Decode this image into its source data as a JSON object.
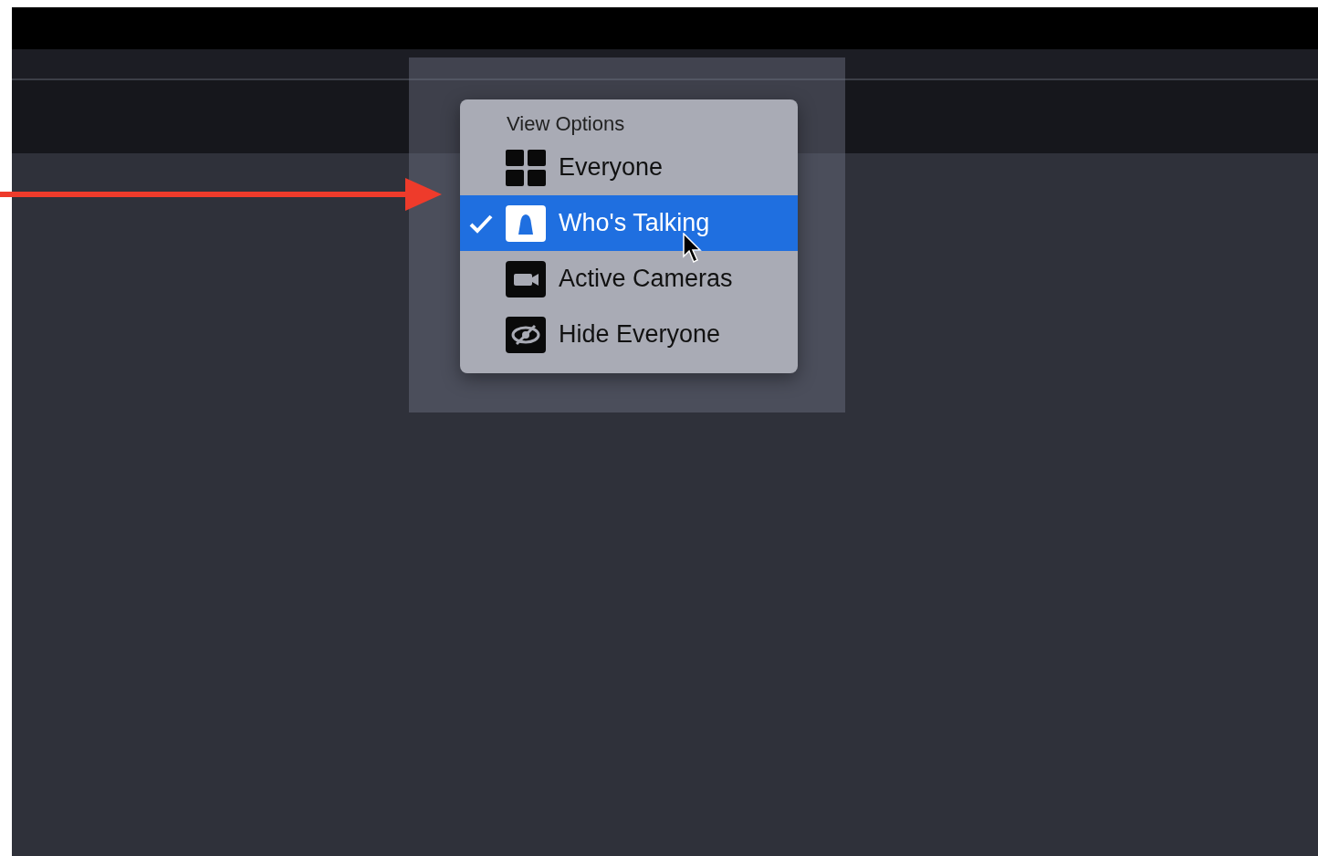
{
  "menu": {
    "title": "View Options",
    "items": [
      {
        "label": "Everyone",
        "selected": false
      },
      {
        "label": "Who's Talking",
        "selected": true
      },
      {
        "label": "Active Cameras",
        "selected": false
      },
      {
        "label": "Hide Everyone",
        "selected": false
      }
    ]
  }
}
